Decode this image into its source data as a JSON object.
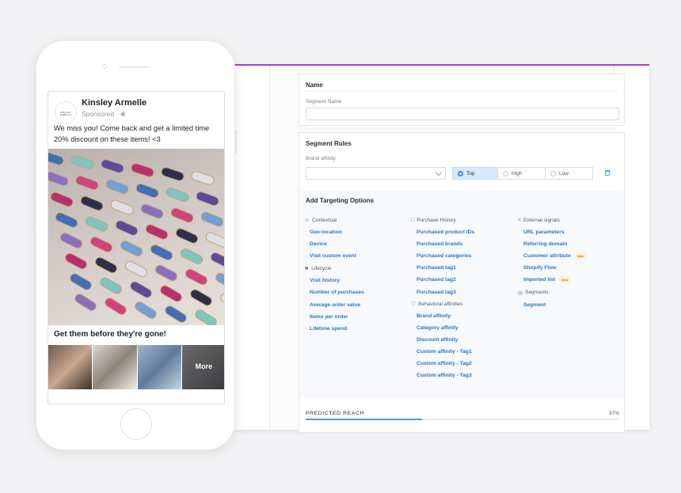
{
  "name_section": {
    "title": "Name",
    "segment_name_label": "Segment Name",
    "segment_name_value": ""
  },
  "rules_section": {
    "title": "Segment Rules",
    "brand_affinity_label": "Brand affinity",
    "brand_affinity_value": "",
    "options": [
      {
        "label": "Top",
        "selected": true
      },
      {
        "label": "High",
        "selected": false
      },
      {
        "label": "Low",
        "selected": false
      }
    ]
  },
  "targeting": {
    "title": "Add Targeting Options",
    "contextual": {
      "heading": "Contextual",
      "items": [
        "Geo-location",
        "Device",
        "Visit custom event"
      ]
    },
    "lifecycle": {
      "heading": "Lifecycle",
      "items": [
        "Visit history",
        "Number of purchases",
        "Average order value",
        "Items per order",
        "Lifetime spend"
      ]
    },
    "purchase_history": {
      "heading": "Purchase History",
      "items": [
        "Purchased product IDs",
        "Purchased brands",
        "Purchased categories",
        "Purchased tag1",
        "Purchased tag2",
        "Purchased tag3"
      ]
    },
    "behavioral_affinities": {
      "heading": "Behavioral affinities",
      "items": [
        "Brand affinity",
        "Category affinity",
        "Discount affinity",
        "Custom affinity - Tag1",
        "Custom affinity - Tag2",
        "Custom affinity - Tag3"
      ]
    },
    "external_signals": {
      "heading": "External signals",
      "items": [
        "URL parameters",
        "Referring domain",
        "Customer attribute",
        "Shopify Flow",
        "Imported list"
      ],
      "new_badge": "New"
    },
    "segments": {
      "heading": "Segments",
      "items": [
        "Segment"
      ]
    }
  },
  "reach": {
    "label": "PREDICTED REACH",
    "percent_text": "37%",
    "percent": 37
  },
  "ad": {
    "avatar_text": "KINSLEY ARMELLE",
    "brand": "Kinsley Armelle",
    "sponsored": "Sponsored · ❀",
    "text": "We miss you! Come back and get a limited time 20% discount on these items! <3",
    "cta": "Get them before they're gone!",
    "more_label": "More"
  },
  "colors": {
    "accent_bar": "#b23ad6",
    "link": "#2a76c9",
    "selected_option_bg": "#d6eafb",
    "reach_fill": "#4a9be5"
  }
}
